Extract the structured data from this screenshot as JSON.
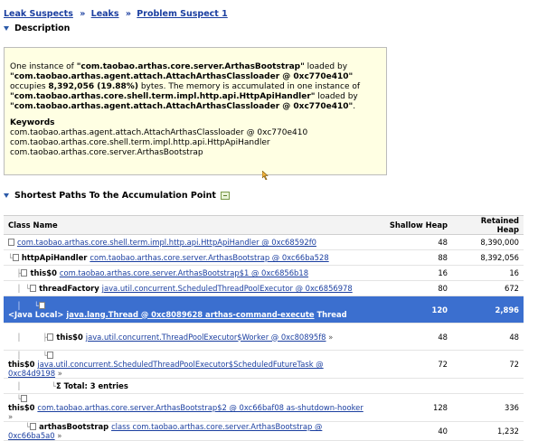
{
  "breadcrumb": {
    "items": [
      "Leak Suspects",
      "Leaks",
      "Problem Suspect 1"
    ],
    "separator": "»"
  },
  "description": {
    "title": "Description",
    "p1_a": "One instance of ",
    "p1_class": "\"com.taobao.arthas.core.server.ArthasBootstrap\"",
    "p1_b": " loaded by",
    "p1_loader": "\"com.taobao.arthas.agent.attach.AttachArthasClassloader @ 0xc770e410\"",
    "p1_c": "occupies ",
    "p1_bytes": "8,392,056 (19.88%)",
    "p1_d": " bytes. The memory is accumulated in one instance of",
    "p1_acc": "\"com.taobao.arthas.core.shell.term.impl.http.api.HttpApiHandler\"",
    "p1_e": " loaded by",
    "p1_loader2": "\"com.taobao.arthas.agent.attach.AttachArthasClassloader @ 0xc770e410\"",
    "p1_end": ".",
    "keywords_title": "Keywords",
    "keywords": [
      "com.taobao.arthas.agent.attach.AttachArthasClassloader @ 0xc770e410",
      "com.taobao.arthas.core.shell.term.impl.http.api.HttpApiHandler",
      "com.taobao.arthas.core.server.ArthasBootstrap"
    ]
  },
  "paths": {
    "title": "Shortest Paths To the Accumulation Point",
    "columns": [
      "Class Name",
      "Shallow Heap",
      "Retained Heap"
    ],
    "rows": [
      {
        "guide": "",
        "prefix": "",
        "link": "com.taobao.arthas.core.shell.term.impl.http.api.HttpApiHandler @ 0xc68592f0",
        "suffix": "",
        "shallow": "48",
        "retained": "8,390,000"
      },
      {
        "guide": "└",
        "prefix": "httpApiHandler ",
        "link": "com.taobao.arthas.core.server.ArthasBootstrap @ 0xc66ba528",
        "suffix": "",
        "shallow": "88",
        "retained": "8,392,056"
      },
      {
        "guide": "  ├",
        "prefix": "this$0 ",
        "link": "com.taobao.arthas.core.server.ArthasBootstrap$1 @ 0xc6856b18",
        "suffix": "",
        "shallow": "16",
        "retained": "16"
      },
      {
        "guide": "  │ └",
        "prefix": "threadFactory ",
        "link": "java.util.concurrent.ScheduledThreadPoolExecutor @ 0xc6856978",
        "suffix": "",
        "shallow": "80",
        "retained": "672"
      },
      {
        "guide": "  │   └",
        "prefix": "<Java Local> ",
        "link": "java.lang.Thread @ 0xc8089628 arthas-command-execute",
        "suffix": " Thread",
        "shallow": "120",
        "retained": "2,896"
      },
      {
        "guide": "  │     ├",
        "prefix": "this$0 ",
        "link": "java.util.concurrent.ThreadPoolExecutor$Worker @ 0xc80895f8",
        "suffix": " »",
        "shallow": "48",
        "retained": "48"
      },
      {
        "guide": "  │     └",
        "prefix": "this$0 ",
        "link": "java.util.concurrent.ScheduledThreadPoolExecutor$ScheduledFutureTask @ 0xc84d9198",
        "suffix": " »",
        "shallow": "72",
        "retained": "72"
      },
      {
        "guide": "  │       └",
        "prefix": "Σ Total: 3 entries",
        "link": "",
        "suffix": "",
        "shallow": "",
        "retained": ""
      },
      {
        "guide": "  └",
        "prefix": "this$0 ",
        "link": "com.taobao.arthas.core.server.ArthasBootstrap$2 @ 0xc66baf08 as-shutdown-hooker",
        "suffix": " »",
        "shallow": "128",
        "retained": "336"
      },
      {
        "guide": "    └",
        "prefix": "arthasBootstrap ",
        "link": "class com.taobao.arthas.core.server.ArthasBootstrap @ 0xc66ba5a0",
        "suffix": " »",
        "shallow": "40",
        "retained": "1,232"
      }
    ]
  }
}
